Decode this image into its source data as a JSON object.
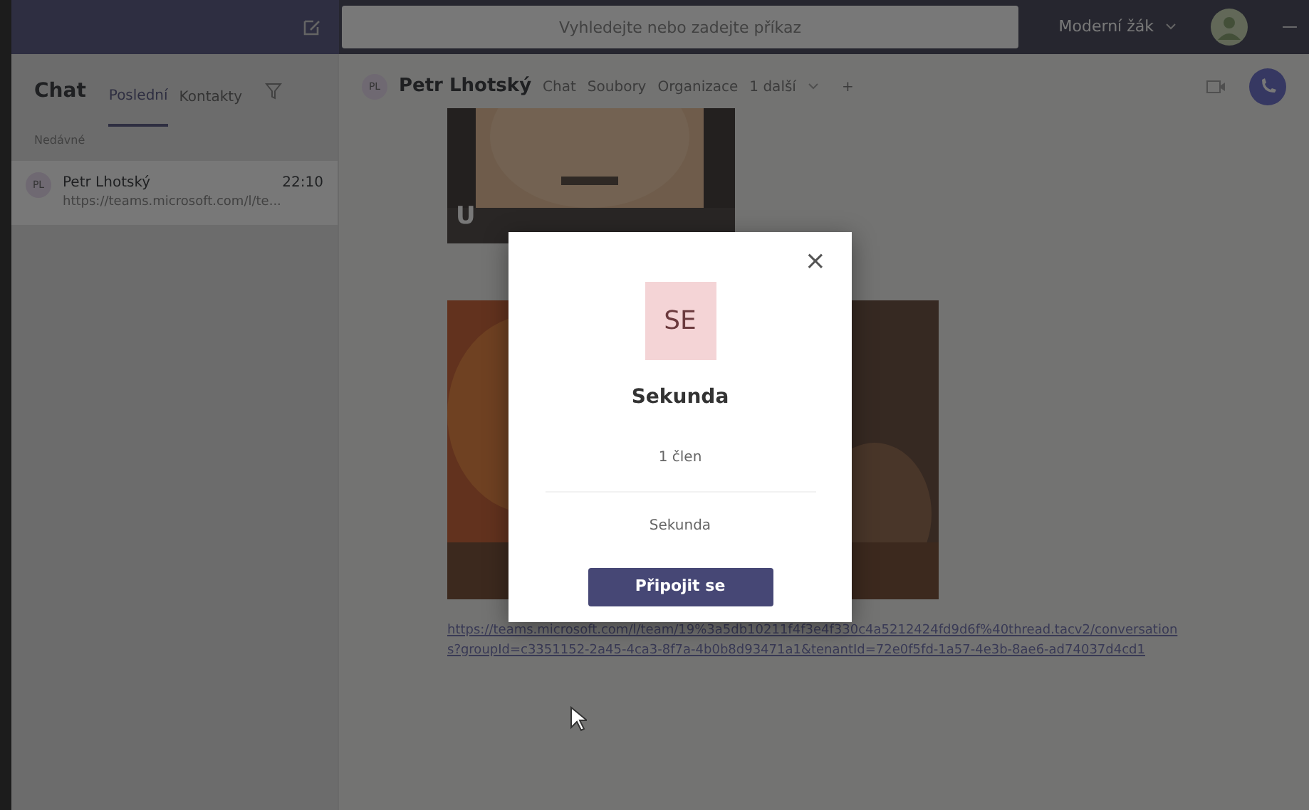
{
  "topbar": {
    "search": {
      "placeholder": "Vyhledejte nebo zadejte příkaz"
    },
    "account": "Moderní žák",
    "window_control": "—"
  },
  "sidebar": {
    "title": "Chat",
    "tabs": [
      {
        "label": "Poslední",
        "selected": true
      },
      {
        "label": "Kontakty",
        "selected": false
      }
    ],
    "section": "Nedávné",
    "chats": [
      {
        "initials": "PL",
        "name": "Petr Lhotský",
        "time": "22:10",
        "preview": "https://teams.microsoft.com/l/te...",
        "selected": true
      }
    ]
  },
  "conversation": {
    "initials": "PL",
    "title": "Petr Lhotský",
    "tabs": [
      "Chat",
      "Soubory",
      "Organizace",
      "1 další"
    ],
    "add": "+",
    "messages": [
      {
        "kind": "card",
        "caption": "U"
      },
      {
        "kind": "picture"
      },
      {
        "kind": "link",
        "text": "https://teams.microsoft.com/l/team/19%3a5db10211f4f3e4f330c4a5212424fd9d6f%40thread.tacv2/conversations?groupId=c3351152-2a45-4ca3-8f7a-4b0b8d93471a1&tenantId=72e0f5fd-1a57-4e3b-8ae6-ad74037d4cd1"
      }
    ]
  },
  "dialog": {
    "close": "×",
    "initials": "SE",
    "name": "Sekunda",
    "members": "1 člen",
    "description": "Sekunda",
    "button": "Připojit se"
  }
}
